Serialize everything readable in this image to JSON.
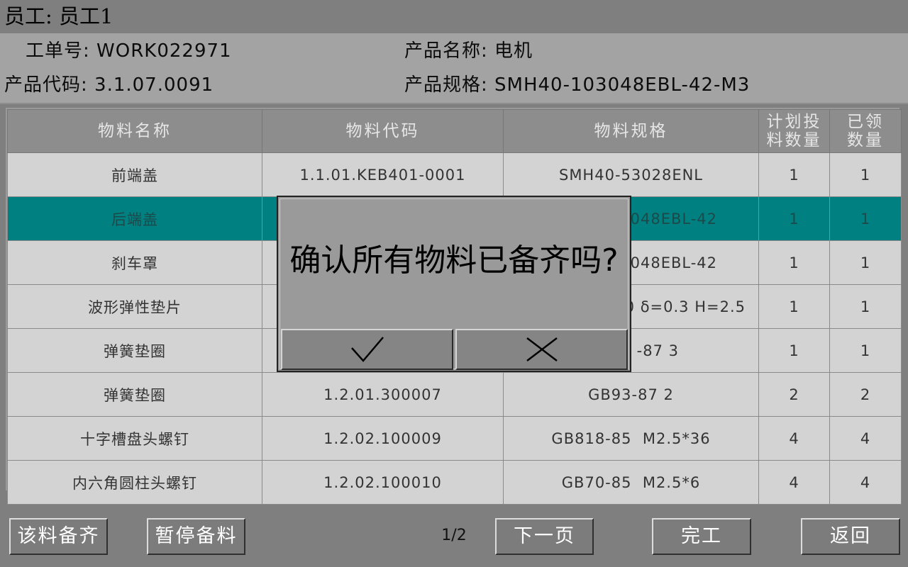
{
  "employee": {
    "label": "员工: 员工1"
  },
  "info": {
    "work_order": "工单号: WORK022971",
    "product_name": "产品名称: 电机",
    "product_code": "产品代码: 3.1.07.0091",
    "product_spec": "产品规格: SMH40-103048EBL-42-M3"
  },
  "table": {
    "headers": [
      "物料名称",
      "物料代码",
      "物料规格",
      "计划投料数量",
      "已领数量"
    ],
    "header_lines": {
      "planned": [
        "计划投",
        "料数量"
      ],
      "received": [
        "已领",
        "数量"
      ]
    },
    "rows": [
      [
        "前端盖",
        "1.1.01.KEB401-0001",
        "SMH40-53028ENL",
        "1",
        "1"
      ],
      [
        "后端盖",
        "",
        "048EBL-42",
        "1",
        "1"
      ],
      [
        "刹车罩",
        "",
        "048EBL-42",
        "1",
        "1"
      ],
      [
        "波形弹性垫片",
        "",
        "0 δ=0.3 H=2.5",
        "1",
        "1"
      ],
      [
        "弹簧垫圈",
        "",
        "-87 3",
        "1",
        "1"
      ],
      [
        "弹簧垫圈",
        "1.2.01.300007",
        "GB93-87 2",
        "2",
        "2"
      ],
      [
        "十字槽盘头螺钉",
        "1.2.02.100009",
        "GB818-85  M2.5*36",
        "4",
        "4"
      ],
      [
        "内六角圆柱头螺钉",
        "1.2.02.100010",
        "GB70-85  M2.5*6",
        "4",
        "4"
      ]
    ]
  },
  "buttons": {
    "material_ready": "该料备齐",
    "pause": "暂停备料",
    "next_page": "下一页",
    "finish": "完工",
    "back": "返回"
  },
  "pagination": {
    "indicator": "1/2"
  },
  "dialog": {
    "message": "确认所有物料已备齐吗?",
    "confirm_icon": "check-icon",
    "cancel_icon": "close-icon"
  },
  "colors": {
    "selected_row": "#008080",
    "background": "#7f7f7f"
  }
}
